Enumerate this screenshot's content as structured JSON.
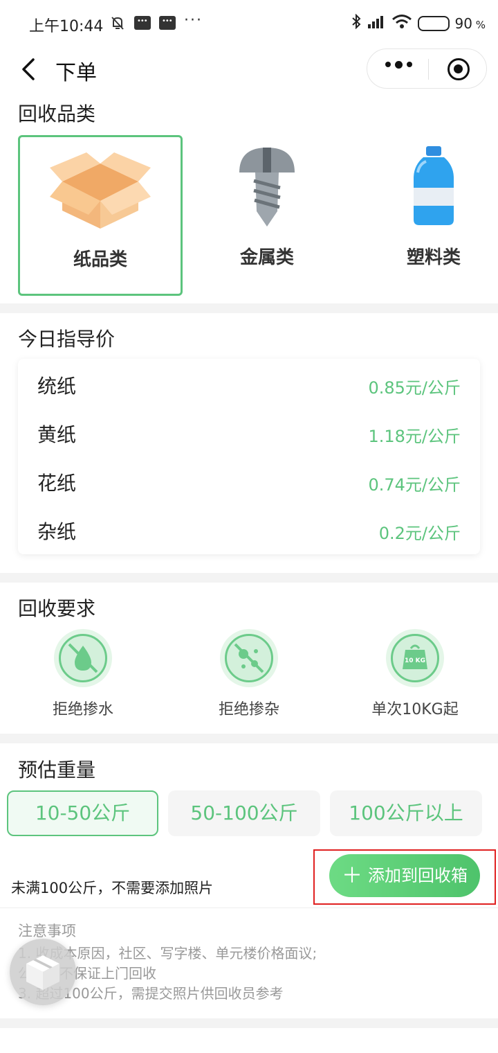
{
  "status_bar": {
    "time": "上午10:44",
    "battery": "90"
  },
  "nav": {
    "title": "下单"
  },
  "categories": {
    "title": "回收品类",
    "items": [
      {
        "label": "纸品类",
        "selected": true
      },
      {
        "label": "金属类",
        "selected": false
      },
      {
        "label": "塑料类",
        "selected": false
      }
    ]
  },
  "prices": {
    "title": "今日指导价",
    "rows": [
      {
        "name": "统纸",
        "value": "0.85元/公斤"
      },
      {
        "name": "黄纸",
        "value": "1.18元/公斤"
      },
      {
        "name": "花纸",
        "value": "0.74元/公斤"
      },
      {
        "name": "杂纸",
        "value": "0.2元/公斤"
      }
    ]
  },
  "requirements": {
    "title": "回收要求",
    "items": [
      {
        "label": "拒绝掺水",
        "icon": "no-water-icon"
      },
      {
        "label": "拒绝掺杂",
        "icon": "no-impurity-icon"
      },
      {
        "label": "单次10KG起",
        "icon": "weight-10kg-icon",
        "badge": "10 KG"
      }
    ]
  },
  "weight": {
    "title": "预估重量",
    "options": [
      {
        "label": "10-50公斤",
        "selected": true
      },
      {
        "label": "50-100公斤",
        "selected": false
      },
      {
        "label": "100公斤以上",
        "selected": false
      }
    ],
    "hint": "未满100公斤，不需要添加照片",
    "add_button": "添加到回收箱"
  },
  "notes": {
    "title": "注意事项",
    "lines": [
      "1.   收成本原因，社区、写字楼、单元楼价格面议;",
      "      公斤暂不保证上门回收",
      "3.   超过100公斤，需提交照片供回收员参考"
    ]
  },
  "colors": {
    "accent": "#5cc47d",
    "highlight": "#e02020"
  }
}
